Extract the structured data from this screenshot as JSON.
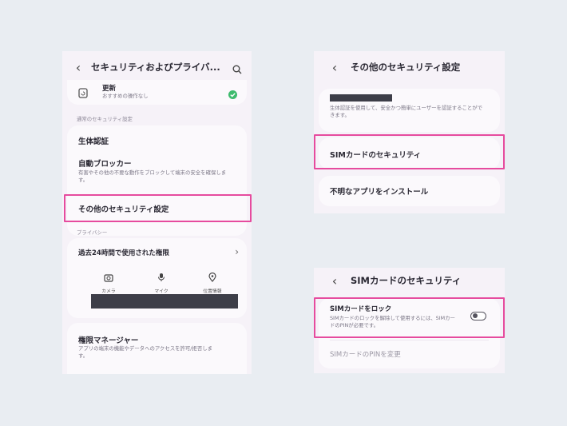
{
  "left_screen": {
    "header": {
      "back_icon": "‹",
      "title": "セキュリティおよびプライバ..."
    },
    "update": {
      "title": "更新",
      "desc": "おすすめの操作なし"
    },
    "section_security": "通常のセキュリティ設定",
    "biometrics": "生体認証",
    "auto_blocker": {
      "title": "自動ブロッカー",
      "desc": "有害やその他の不要な動作をブロックして端末の安全を確保します。"
    },
    "other_security": "その他のセキュリティ設定",
    "section_privacy": "プライバシー",
    "recent_perms": "過去24時間で使用された権限",
    "perm_items": [
      "カメラ",
      "マイク",
      "位置情報"
    ],
    "perm_manager": {
      "title": "権限マネージャー",
      "desc": "アプリの端末の機能やデータへのアクセスを許可/拒否します。"
    }
  },
  "top_right_screen": {
    "header": {
      "back_icon": "‹",
      "title": "その他のセキュリティ設定"
    },
    "card_desc": "生体認証を使用して、安全かつ簡単にユーザーを認証することができます。",
    "sim_security": "SIMカードのセキュリティ",
    "install_unknown": "不明なアプリをインストール"
  },
  "bottom_right_screen": {
    "header": {
      "back_icon": "‹",
      "title": "SIMカードのセキュリティ"
    },
    "sim_lock": {
      "title": "SIMカードをロック",
      "desc": "SIMカードのロックを解除して使用するには、SIMカードのPINが必要です。"
    },
    "sim_lock_enabled": false,
    "change_pin": "SIMカードのPINを変更"
  },
  "colors": {
    "highlight": "#e64b9e",
    "accent_green": "#3dbb6d",
    "background": "#e9edf2"
  }
}
